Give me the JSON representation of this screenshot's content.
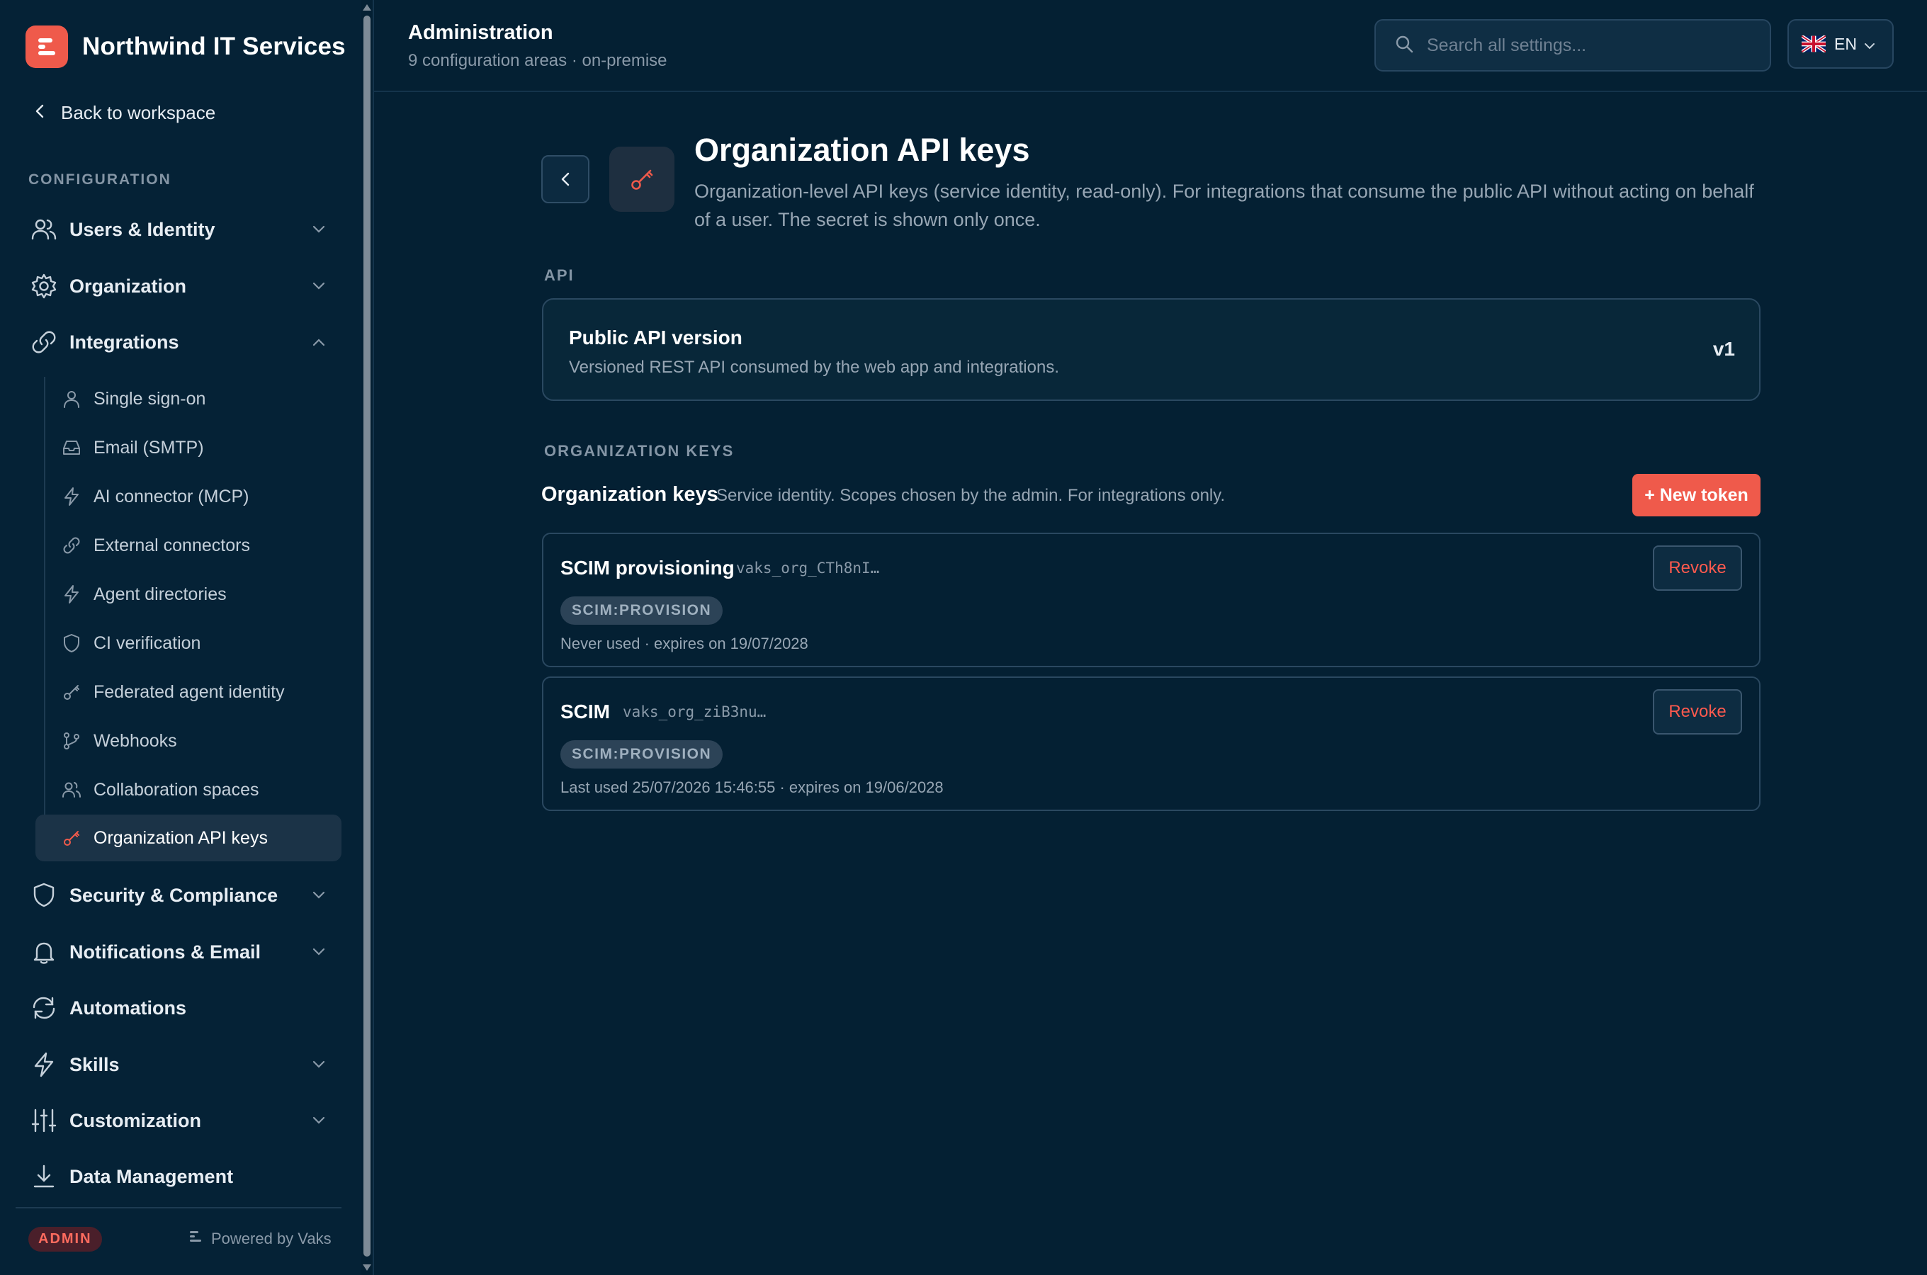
{
  "sidebar": {
    "brand": "Northwind IT Services",
    "back_link": "Back to workspace",
    "section_label": "CONFIGURATION",
    "nav": [
      {
        "label": "Users & Identity",
        "icon": "users-icon",
        "expanded": false
      },
      {
        "label": "Organization",
        "icon": "gear-icon",
        "expanded": false
      },
      {
        "label": "Integrations",
        "icon": "link-icon",
        "expanded": true
      },
      {
        "label": "Security & Compliance",
        "icon": "shield-icon",
        "expanded": false
      },
      {
        "label": "Notifications & Email",
        "icon": "bell-icon",
        "expanded": false
      },
      {
        "label": "Automations",
        "icon": "refresh-icon"
      },
      {
        "label": "Skills",
        "icon": "bolt-icon",
        "expanded": false
      },
      {
        "label": "Customization",
        "icon": "sliders-icon",
        "expanded": false
      },
      {
        "label": "Data Management",
        "icon": "download-icon"
      }
    ],
    "sub_items": [
      {
        "label": "Single sign-on",
        "icon": "user-icon"
      },
      {
        "label": "Email (SMTP)",
        "icon": "inbox-icon"
      },
      {
        "label": "AI connector (MCP)",
        "icon": "bolt-icon"
      },
      {
        "label": "External connectors",
        "icon": "link-icon"
      },
      {
        "label": "Agent directories",
        "icon": "bolt-icon"
      },
      {
        "label": "CI verification",
        "icon": "shield-icon"
      },
      {
        "label": "Federated agent identity",
        "icon": "key-icon"
      },
      {
        "label": "Webhooks",
        "icon": "git-branch-icon"
      },
      {
        "label": "Collaboration spaces",
        "icon": "users-icon"
      },
      {
        "label": "Organization API keys",
        "icon": "key-icon",
        "active": true
      }
    ],
    "role_badge": "ADMIN",
    "powered_by": "Powered by Vaks"
  },
  "header": {
    "title": "Administration",
    "subtitle": "9 configuration areas · on-premise",
    "search_placeholder": "Search all settings...",
    "language": "EN"
  },
  "page": {
    "title": "Organization API keys",
    "description": "Organization-level API keys (service identity, read-only). For integrations that consume the public API without acting on behalf of a user. The secret is shown only once.",
    "api_section_label": "API",
    "api_card": {
      "title": "Public API version",
      "description": "Versioned REST API consumed by the web app and integrations.",
      "version": "v1"
    },
    "keys_section_label": "ORGANIZATION KEYS",
    "keys_title": "Organization keys",
    "keys_description": "Service identity. Scopes chosen by the admin. For integrations only.",
    "new_token_label": "+ New token",
    "keys": [
      {
        "name": "SCIM provisioning",
        "prefix": "vaks_org_CTh8nI…",
        "scope": "SCIM:PROVISION",
        "meta": "Never used · expires on 19/07/2028",
        "revoke_label": "Revoke"
      },
      {
        "name": "SCIM",
        "prefix": "vaks_org_ziB3nu…",
        "scope": "SCIM:PROVISION",
        "meta": "Last used 25/07/2026 15:46:55 · expires on 19/06/2028",
        "revoke_label": "Revoke"
      }
    ]
  },
  "colors": {
    "accent": "#ef5a4b",
    "background": "#042033",
    "danger_text": "#ff5a4e"
  }
}
